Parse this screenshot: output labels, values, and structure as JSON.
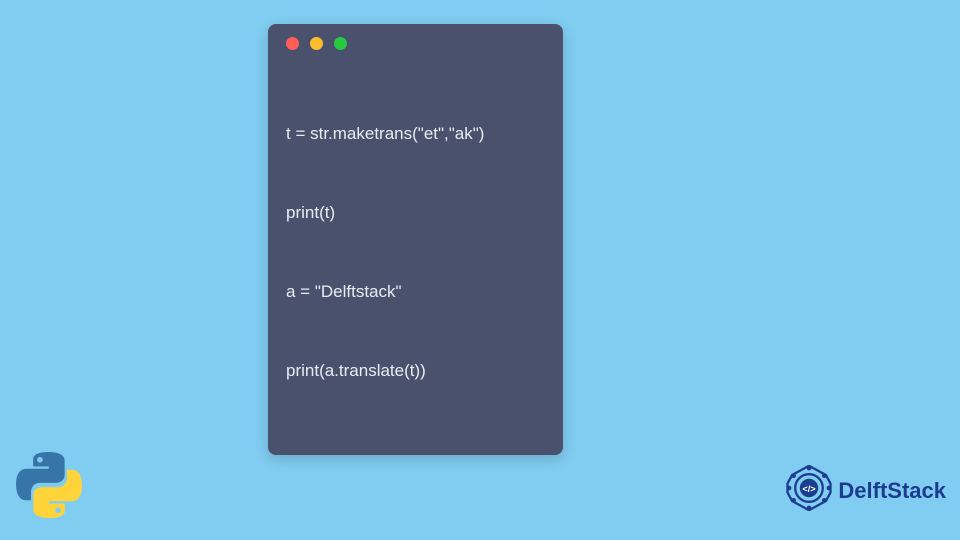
{
  "window": {
    "dots": {
      "red": "#ff5f57",
      "yellow": "#febc2e",
      "green": "#28c840"
    },
    "bg": "#4a516d"
  },
  "code": {
    "line1": "t = str.maketrans(\"et\",\"ak\")",
    "line2": "print(t)",
    "line3": "a = \"Delftstack\"",
    "line4": "print(a.translate(t))"
  },
  "logos": {
    "python_name": "python-logo",
    "delftstack_name": "delftstack-logo",
    "delftstack_text": "DelftStack"
  },
  "colors": {
    "page_bg": "#81cdf2",
    "code_fg": "#e8ecf1",
    "delft_blue": "#1c3d8f",
    "py_blue": "#3775a9",
    "py_yellow": "#ffd43b"
  }
}
